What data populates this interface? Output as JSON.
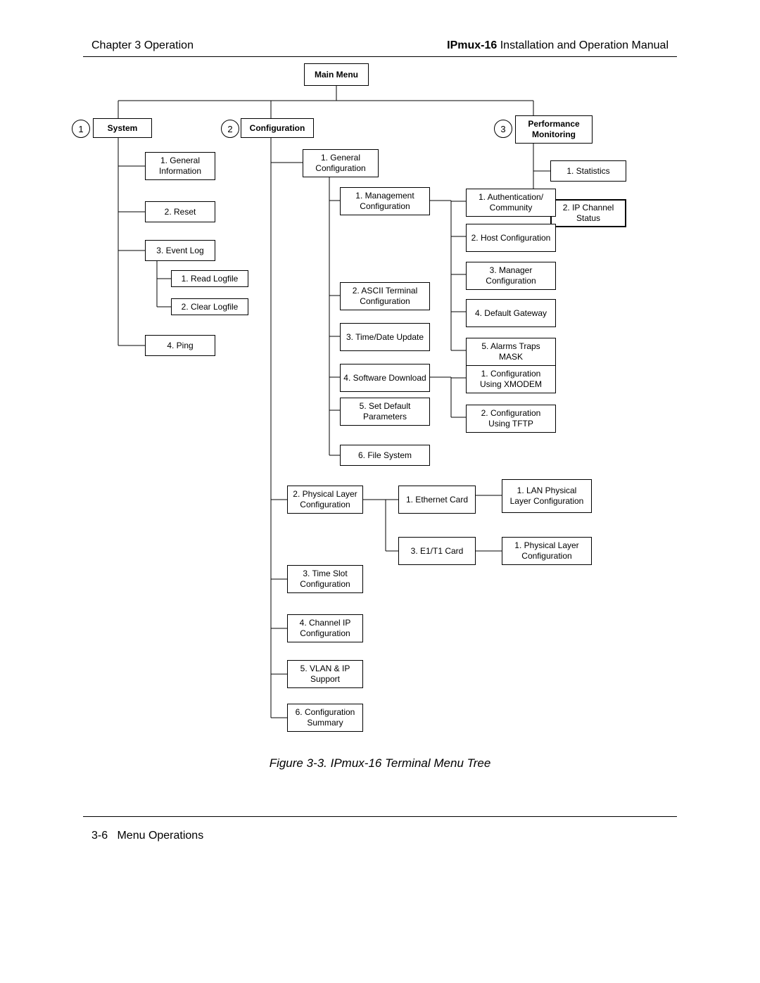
{
  "header": {
    "left": "Chapter 3  Operation",
    "right_bold": "IPmux-16",
    "right_rest": " Installation and Operation Manual"
  },
  "caption": "Figure 3-3.  IPmux-16 Terminal Menu Tree",
  "footer_page": "3-6",
  "footer_title": "Menu Operations",
  "root": "Main Menu",
  "branches": {
    "b1": {
      "num": "1",
      "label": "System"
    },
    "b2": {
      "num": "2",
      "label": "Configuration"
    },
    "b3": {
      "num": "3",
      "label": "Performance Monitoring"
    }
  },
  "system": {
    "s1": "1. General Information",
    "s2": "2. Reset",
    "s3": "3. Event Log",
    "s3a": "1. Read Logfile",
    "s3b": "2. Clear Logfile",
    "s4": "4. Ping"
  },
  "perf": {
    "p1": "1. Statistics",
    "p2": "2. IP Channel Status"
  },
  "config_top": {
    "c1": "1. General Configuration"
  },
  "gen": {
    "g1": "1. Management Configuration",
    "g2": "2. ASCII Terminal Configuration",
    "g3": "3. Time/Date Update",
    "g4": "4. Software Download",
    "g5": "5. Set Default Parameters",
    "g6": "6. File System"
  },
  "mgmt": {
    "m1": "1. Authentication/ Community",
    "m2": "2. Host Configuration",
    "m3": "3. Manager Configuration",
    "m4": "4. Default Gateway",
    "m5": "5. Alarms Traps MASK"
  },
  "sw": {
    "d1": "1. Configuration Using XMODEM",
    "d2": "2. Configuration Using TFTP"
  },
  "cfg_rest": {
    "c2": "2. Physical Layer Configuration",
    "c3": "3. Time Slot Configuration",
    "c4": "4. Channel IP Configuration",
    "c5": "5. VLAN & IP Support",
    "c6": "6. Configuration Summary"
  },
  "pl_cards": {
    "e1": "1. Ethernet Card",
    "e2": "3. E1/T1 Card"
  },
  "pl_sub": {
    "lan": "1. LAN Physical Layer Configuration",
    "phy": "1. Physical Layer Configuration"
  }
}
